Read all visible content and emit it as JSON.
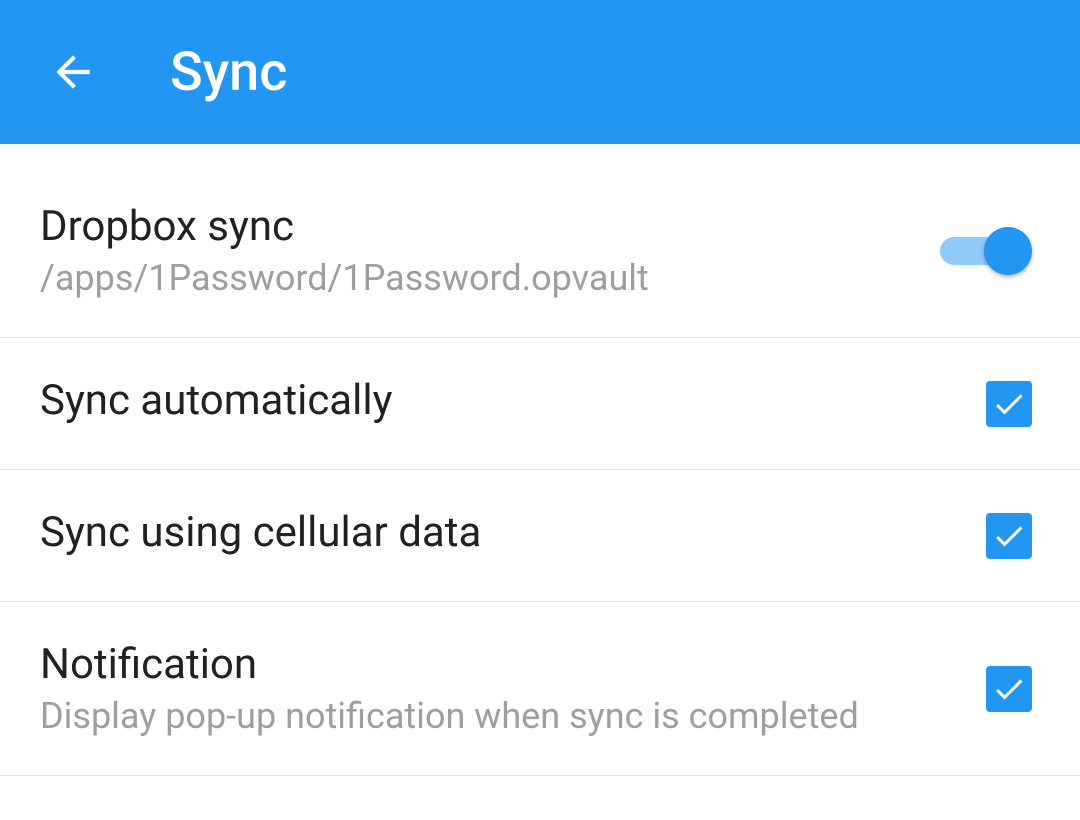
{
  "header": {
    "title": "Sync"
  },
  "items": [
    {
      "title": "Dropbox sync",
      "subtitle": "/apps/1Password/1Password.opvault",
      "control": "switch",
      "checked": true
    },
    {
      "title": "Sync automatically",
      "subtitle": null,
      "control": "checkbox",
      "checked": true
    },
    {
      "title": "Sync using cellular data",
      "subtitle": null,
      "control": "checkbox",
      "checked": true
    },
    {
      "title": "Notification",
      "subtitle": "Display pop-up notification when sync is completed",
      "control": "checkbox",
      "checked": true
    }
  ]
}
